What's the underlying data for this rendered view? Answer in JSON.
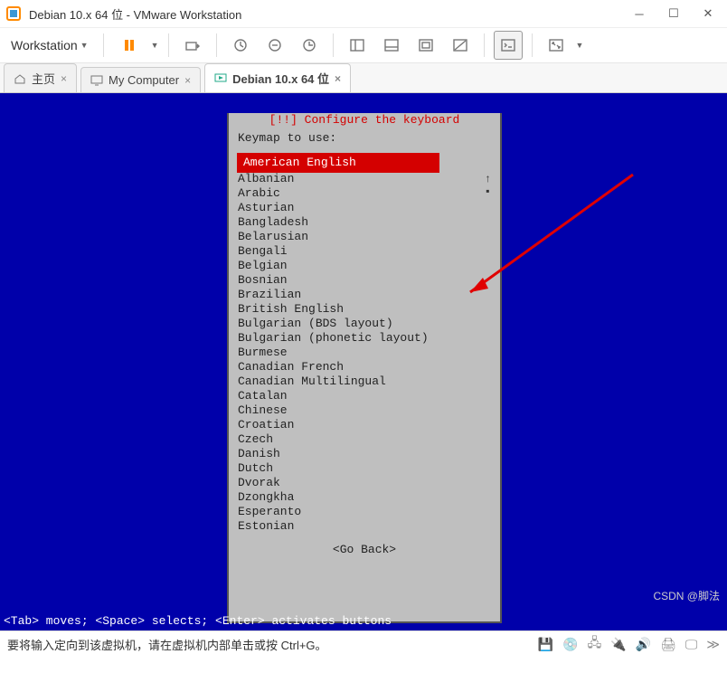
{
  "window": {
    "title": "Debian 10.x 64 位 - VMware Workstation"
  },
  "menu": {
    "workstation": "Workstation"
  },
  "tabs": {
    "home": "主页",
    "mycomputer": "My Computer",
    "vm": "Debian 10.x 64 位"
  },
  "installer": {
    "title": "[!!] Configure the keyboard",
    "prompt": "Keymap to use:",
    "selected": "American English",
    "items": [
      "Albanian",
      "Arabic",
      "Asturian",
      "Bangladesh",
      "Belarusian",
      "Bengali",
      "Belgian",
      "Bosnian",
      "Brazilian",
      "British English",
      "Bulgarian (BDS layout)",
      "Bulgarian (phonetic layout)",
      "Burmese",
      "Canadian French",
      "Canadian Multilingual",
      "Catalan",
      "Chinese",
      "Croatian",
      "Czech",
      "Danish",
      "Dutch",
      "Dvorak",
      "Dzongkha",
      "Esperanto",
      "Estonian"
    ],
    "go_back": "<Go Back>",
    "hint": "<Tab> moves; <Space> selects; <Enter> activates buttons"
  },
  "status": {
    "msg": "要将输入定向到该虚拟机，请在虚拟机内部单击或按 Ctrl+G。",
    "watermark": "CSDN @脚法"
  }
}
